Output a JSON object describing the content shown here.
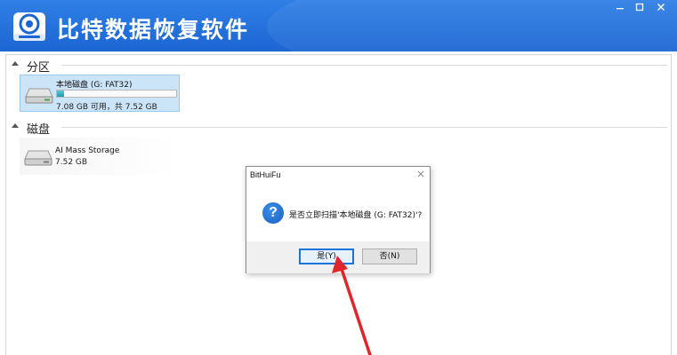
{
  "app": {
    "title": "比特数据恢复软件",
    "brand_color": "#2275dc"
  },
  "window_controls": {
    "minimize_icon": "minimize-icon",
    "maximize_icon": "maximize-icon",
    "close_icon": "close-icon"
  },
  "sections": {
    "partitions": {
      "label": "分区",
      "items": [
        {
          "name": "本地磁盘 (G: FAT32)",
          "size": "7.08 GB 可用，共 7.52 GB",
          "used_fraction": 0.06
        }
      ]
    },
    "disks": {
      "label": "磁盘",
      "items": [
        {
          "name": "AI Mass Storage",
          "size": "7.52 GB"
        }
      ]
    }
  },
  "dialog": {
    "title": "BitHuiFu",
    "close_icon": "close-icon",
    "icon": "question-icon",
    "message": "是否立即扫描'本地磁盘 (G: FAT32)'?",
    "yes_label": "是(Y)",
    "no_label": "否(N)"
  },
  "annotation": {
    "color": "#e0262a"
  }
}
